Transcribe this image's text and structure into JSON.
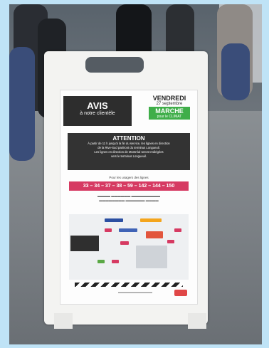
{
  "sign": {
    "avis_title": "AVIS",
    "avis_subtitle": "à notre clientèle",
    "day": "VENDREDI",
    "date": "27 septembre",
    "marche": "MARCHE",
    "marche_sub": "pour le CLIMAT",
    "attention_title": "ATTENTION",
    "attention_lines": [
      "À partir de 11 h jusqu'à la fin du service, les lignes en direction",
      "de la Rive-Sud partiront du terminus Longueuil.",
      "Les lignes en direction de Montréal seront redirigées",
      "vers le terminus Longueuil."
    ],
    "usagers": "Pour les usagers des lignes",
    "routes": "33 – 34 – 37 – 38 – 59 – 142 – 144 – 150"
  },
  "colors": {
    "routes_bg": "#d63a62",
    "marche_bg": "#3fae49",
    "box_bg": "#2d2d2d"
  }
}
